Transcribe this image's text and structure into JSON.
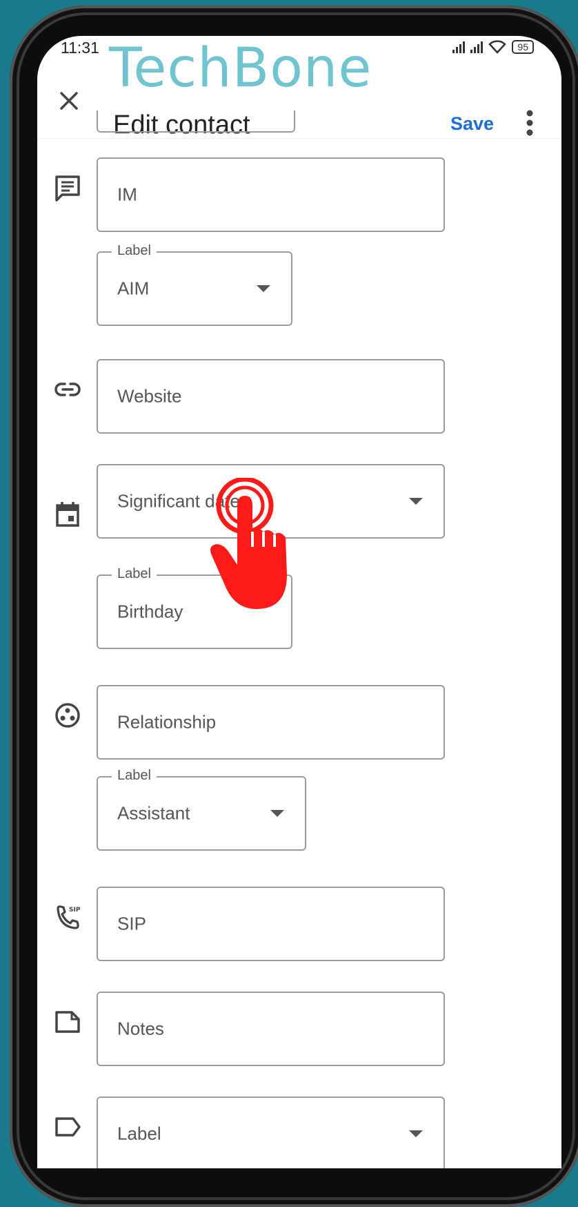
{
  "status": {
    "time": "11:31",
    "battery": "95"
  },
  "watermark": "TechBone",
  "app_bar": {
    "title": "Edit contact",
    "save_label": "Save"
  },
  "fields": {
    "im": {
      "placeholder": "IM"
    },
    "im_label": {
      "legend": "Label",
      "value": "AIM"
    },
    "website": {
      "placeholder": "Website"
    },
    "significant_date": {
      "placeholder": "Significant date"
    },
    "date_label": {
      "legend": "Label",
      "value": "Birthday"
    },
    "relationship": {
      "placeholder": "Relationship"
    },
    "relationship_label": {
      "legend": "Label",
      "value": "Assistant"
    },
    "sip": {
      "placeholder": "SIP"
    },
    "notes": {
      "placeholder": "Notes"
    },
    "label": {
      "placeholder": "Label"
    }
  },
  "icons": {
    "im": "message-icon",
    "website": "link-icon",
    "date": "calendar-icon",
    "relationship": "relationship-icon",
    "sip": "sip-phone-icon",
    "notes": "notes-icon",
    "label": "label-tag-icon",
    "tap": "tap-gesture-icon"
  },
  "colors": {
    "accent": "#1a6fd1",
    "background": "#1a7a8c",
    "watermark": "#6fc4d0",
    "tap": "#ff1a1a"
  }
}
